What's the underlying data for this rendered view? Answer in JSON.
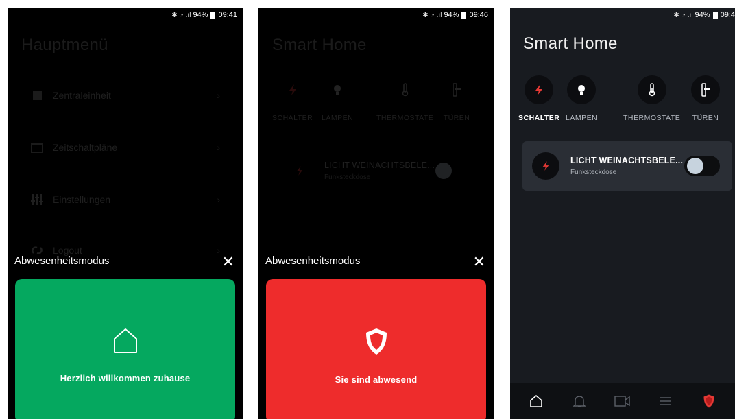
{
  "colors": {
    "green": "#05a85f",
    "red": "#ee2c2c",
    "dark_bg": "#181b20",
    "card_bg": "#2a2e35",
    "lightning_red": "#e53935"
  },
  "status_bar": [
    {
      "icons": [
        "bluetooth-icon",
        "wifi-icon",
        "signal-icon"
      ],
      "battery": "94%",
      "time": "09:41"
    },
    {
      "icons": [
        "bluetooth-icon",
        "wifi-icon",
        "signal-icon"
      ],
      "battery": "94%",
      "time": "09:46"
    },
    {
      "icons": [
        "bluetooth-icon",
        "wifi-icon",
        "signal-icon"
      ],
      "battery": "94%",
      "time": "09:4"
    }
  ],
  "screen1": {
    "title": "Hauptmenü",
    "menu": [
      {
        "label": "Zentraleinheit",
        "icon": "square-icon"
      },
      {
        "label": "Zeitschaltpläne",
        "icon": "calendar-icon"
      },
      {
        "label": "Einstellungen",
        "icon": "sliders-icon"
      },
      {
        "label": "Logout",
        "icon": "logout-icon"
      }
    ],
    "sheet": {
      "title": "Abwesenheitsmodus",
      "close": "✕",
      "mode_label": "Herzlich willkommen zuhause",
      "mode_icon": "home-outline-icon"
    }
  },
  "screen2": {
    "title": "Smart Home",
    "device": {
      "name": "LICHT WEINACHTSBELE...",
      "type": "Funksteckdose"
    },
    "sheet": {
      "title": "Abwesenheitsmodus",
      "close": "✕",
      "mode_label": "Sie sind abwesend",
      "mode_icon": "shield-icon"
    }
  },
  "screen3": {
    "title": "Smart Home",
    "categories": [
      {
        "label": "SCHALTER",
        "icon": "lightning-icon",
        "active": true
      },
      {
        "label": "LAMPEN",
        "icon": "bulb-icon",
        "active": false
      },
      {
        "label": "THERMOSTATE",
        "icon": "thermometer-icon",
        "active": false
      },
      {
        "label": "TÜREN",
        "icon": "door-handle-icon",
        "active": false
      }
    ],
    "device": {
      "name": "LICHT WEINACHTSBELE...",
      "type": "Funksteckdose",
      "on": false
    },
    "nav": [
      "home-icon",
      "bell-icon",
      "video-icon",
      "menu-icon",
      "shield-icon"
    ]
  },
  "screen2_categories": [
    "SCHALTER",
    "LAMPEN",
    "THERMOSTATE",
    "TÜREN"
  ]
}
